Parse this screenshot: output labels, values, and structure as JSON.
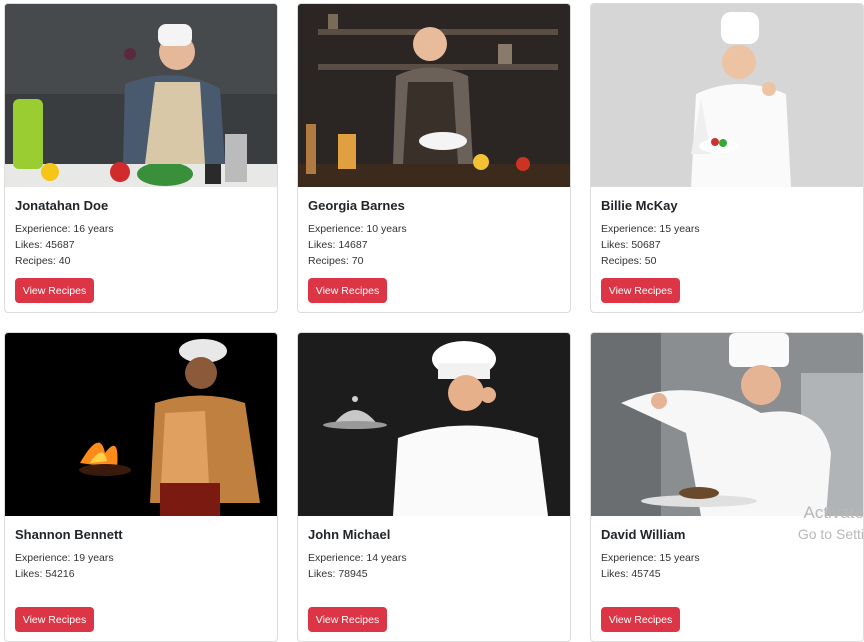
{
  "chefs": [
    {
      "name": "Jonatahan Doe",
      "experience": "Experience: 16 years",
      "likes": "Likes: 45687",
      "recipes": "Recipes: 40",
      "button": "View Recipes"
    },
    {
      "name": "Georgia Barnes",
      "experience": "Experience: 10 years",
      "likes": "Likes: 14687",
      "recipes": "Recipes: 70",
      "button": "View Recipes"
    },
    {
      "name": "Billie McKay",
      "experience": "Experience: 15 years",
      "likes": "Likes: 50687",
      "recipes": "Recipes: 50",
      "button": "View Recipes"
    },
    {
      "name": "Shannon Bennett",
      "experience": "Experience: 19 years",
      "likes": "Likes: 54216",
      "recipes": "",
      "button": "View Recipes"
    },
    {
      "name": "John Michael",
      "experience": "Experience: 14 years",
      "likes": "Likes: 78945",
      "recipes": "",
      "button": "View Recipes"
    },
    {
      "name": "David William",
      "experience": "Experience: 15 years",
      "likes": "Likes: 45745",
      "recipes": "",
      "button": "View Recipes"
    }
  ],
  "watermark": {
    "line1": "Activate",
    "line2": "Go to Setti"
  },
  "colors": {
    "button": "#dc3545",
    "card_border": "#dcdcdc"
  }
}
